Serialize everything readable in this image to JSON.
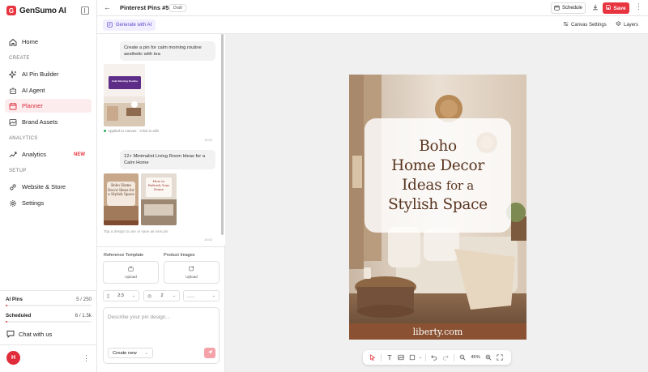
{
  "app": {
    "logo_mark": "G",
    "name": "GenSumo AI"
  },
  "sidebar": {
    "home": "Home",
    "section_create": "CREATE",
    "pin_builder": "AI Pin Builder",
    "agent": "AI Agent",
    "planner": "Planner",
    "brand_assets": "Brand Assets",
    "section_analytics": "ANALYTICS",
    "analytics": "Analytics",
    "analytics_badge": "NEW",
    "section_setup": "SETUP",
    "website_store": "Website & Store",
    "settings": "Settings",
    "usage": [
      {
        "label": "AI Pins",
        "value": "5 / 250",
        "fraction": 0.02
      },
      {
        "label": "Scheduled",
        "value": "6 / 1.5k",
        "fraction": 0.004
      }
    ],
    "chat": "Chat with us",
    "avatar": "H"
  },
  "topbar": {
    "title": "Pinterest Pins #5",
    "status": "Draft",
    "schedule": "Schedule",
    "save": "Save"
  },
  "subbar": {
    "generate": "Generate with AI",
    "canvas_settings": "Canvas Settings",
    "layers": "Layers"
  },
  "chat": {
    "msg1": "Create a pin for calm morning routine aesthetic with tea",
    "thumb1_title": "Calm Morning Routine",
    "applied": "Applied to canvas · Click to edit",
    "time1": "16:03",
    "msg2": "12+ Minimalist Living Room Ideas for a Calm Home",
    "thumb2_title": "Boho Home Decor Ideas for a Stylish Space",
    "thumb3_title": "How to Refresh Your Home",
    "hint": "Tap a design to use or save as new pin",
    "time2": "16:03"
  },
  "composer": {
    "reference_label": "Reference Template",
    "product_label": "Product Images",
    "upload": "Upload",
    "aspect": "2:3",
    "count": "2",
    "model": "___",
    "placeholder": "Describe your pin design...",
    "mode": "Create new"
  },
  "pin": {
    "line1": "Boho",
    "line2": "Home Decor",
    "line3a": "Ideas",
    "line3b": "for a",
    "line4": "Stylish Space",
    "footer": "liberty.com"
  },
  "toolbar": {
    "zoom": "45%"
  },
  "colors": {
    "accent": "#e8343f",
    "ai_purple": "#5b47c7",
    "pin_footer": "#8a5232"
  }
}
